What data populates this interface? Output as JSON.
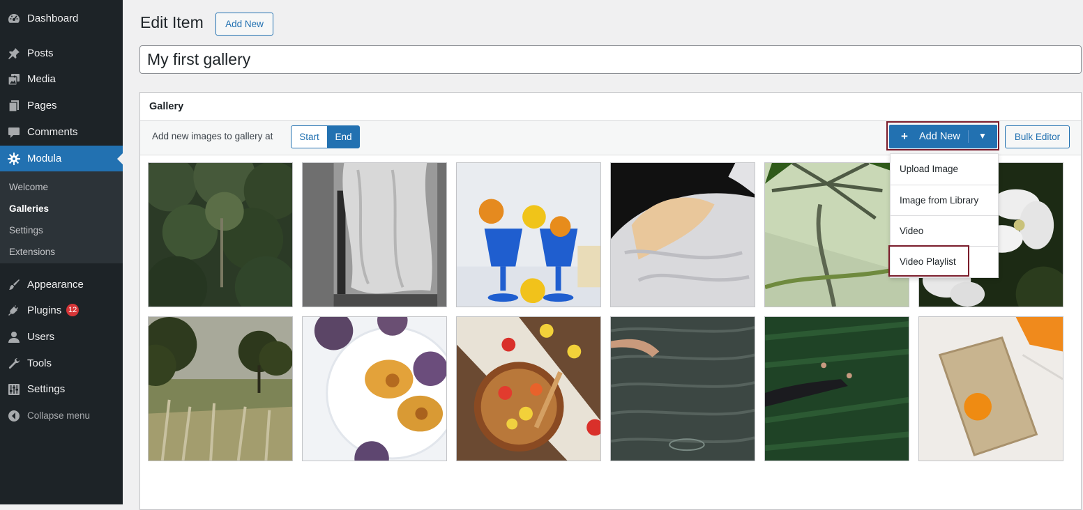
{
  "sidebar": {
    "items": [
      {
        "label": "Dashboard",
        "icon": "dashboard-icon"
      },
      {
        "label": "Posts",
        "icon": "pin-icon"
      },
      {
        "label": "Media",
        "icon": "media-icon"
      },
      {
        "label": "Pages",
        "icon": "pages-icon"
      },
      {
        "label": "Comments",
        "icon": "comment-icon"
      },
      {
        "label": "Modula",
        "icon": "gear-icon",
        "active": true
      },
      {
        "label": "Appearance",
        "icon": "brush-icon"
      },
      {
        "label": "Plugins",
        "icon": "plug-icon",
        "badge": "12"
      },
      {
        "label": "Users",
        "icon": "user-icon"
      },
      {
        "label": "Tools",
        "icon": "wrench-icon"
      },
      {
        "label": "Settings",
        "icon": "settings-sliders-icon"
      }
    ],
    "submenu": [
      "Welcome",
      "Galleries",
      "Settings",
      "Extensions"
    ],
    "submenu_current": "Galleries",
    "collapse_label": "Collapse menu",
    "active_color": "#2271b1"
  },
  "header": {
    "title": "Edit Item",
    "add_new_label": "Add New"
  },
  "title_input": {
    "value": "My first gallery"
  },
  "gallery": {
    "heading": "Gallery",
    "position_label": "Add new images to gallery at",
    "position_options": [
      "Start",
      "End"
    ],
    "position_selected": "End",
    "add_new_button": {
      "plus": "+",
      "label": "Add New",
      "caret": "▼"
    },
    "bulk_editor_label": "Bulk Editor",
    "dropdown_items": [
      "Upload Image",
      "Image from Library",
      "Video",
      "Video Playlist"
    ],
    "highlight_color": "#7a1c2b",
    "thumbnails": [
      "forest",
      "window-curtain",
      "blue-glasses-fruit",
      "bed-sheets",
      "palm-shadow",
      "white-flowers",
      "grass-trees",
      "plums-plate",
      "fruit-bowl",
      "hand-water",
      "person-grass",
      "book-orange"
    ]
  }
}
